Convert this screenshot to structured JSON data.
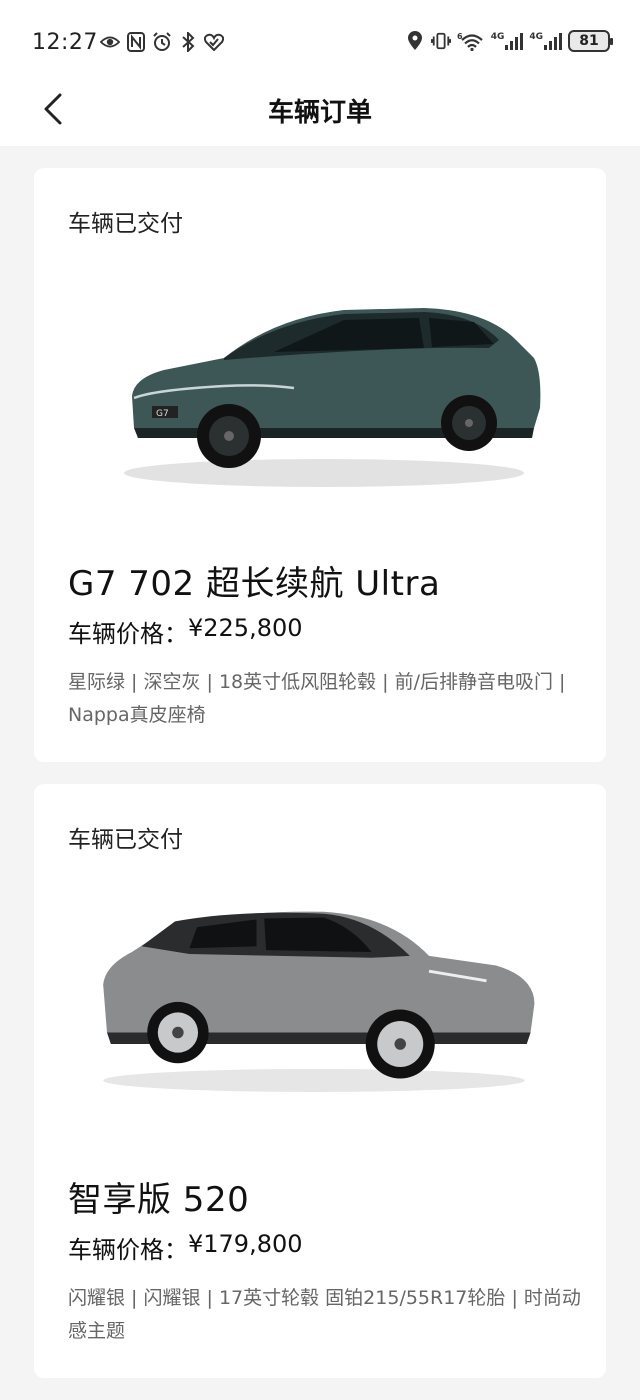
{
  "status_bar": {
    "time": "12:27",
    "battery": "81",
    "network_1": "4G",
    "network_2": "4G",
    "wifi_sub": "6"
  },
  "header": {
    "title": "车辆订单",
    "back_icon": "chevron-left-icon"
  },
  "orders": [
    {
      "status": "车辆已交付",
      "model": "G7 702 超长续航 Ultra",
      "price_label": "车辆价格：",
      "price": "¥225,800",
      "options": "星际绿 | 深空灰 | 18英寸低风阻轮毂 | 前/后排静音电吸门 | Nappa真皮座椅",
      "car_color": "#3d5656",
      "car_badge": "G7"
    },
    {
      "status": "车辆已交付",
      "model": "智享版 520",
      "price_label": "车辆价格：",
      "price": "¥179,800",
      "options": "闪耀银 | 闪耀银 | 17英寸轮毂 固铂215/55R17轮胎 | 时尚动感主题",
      "car_color": "#8a8c8e"
    }
  ]
}
